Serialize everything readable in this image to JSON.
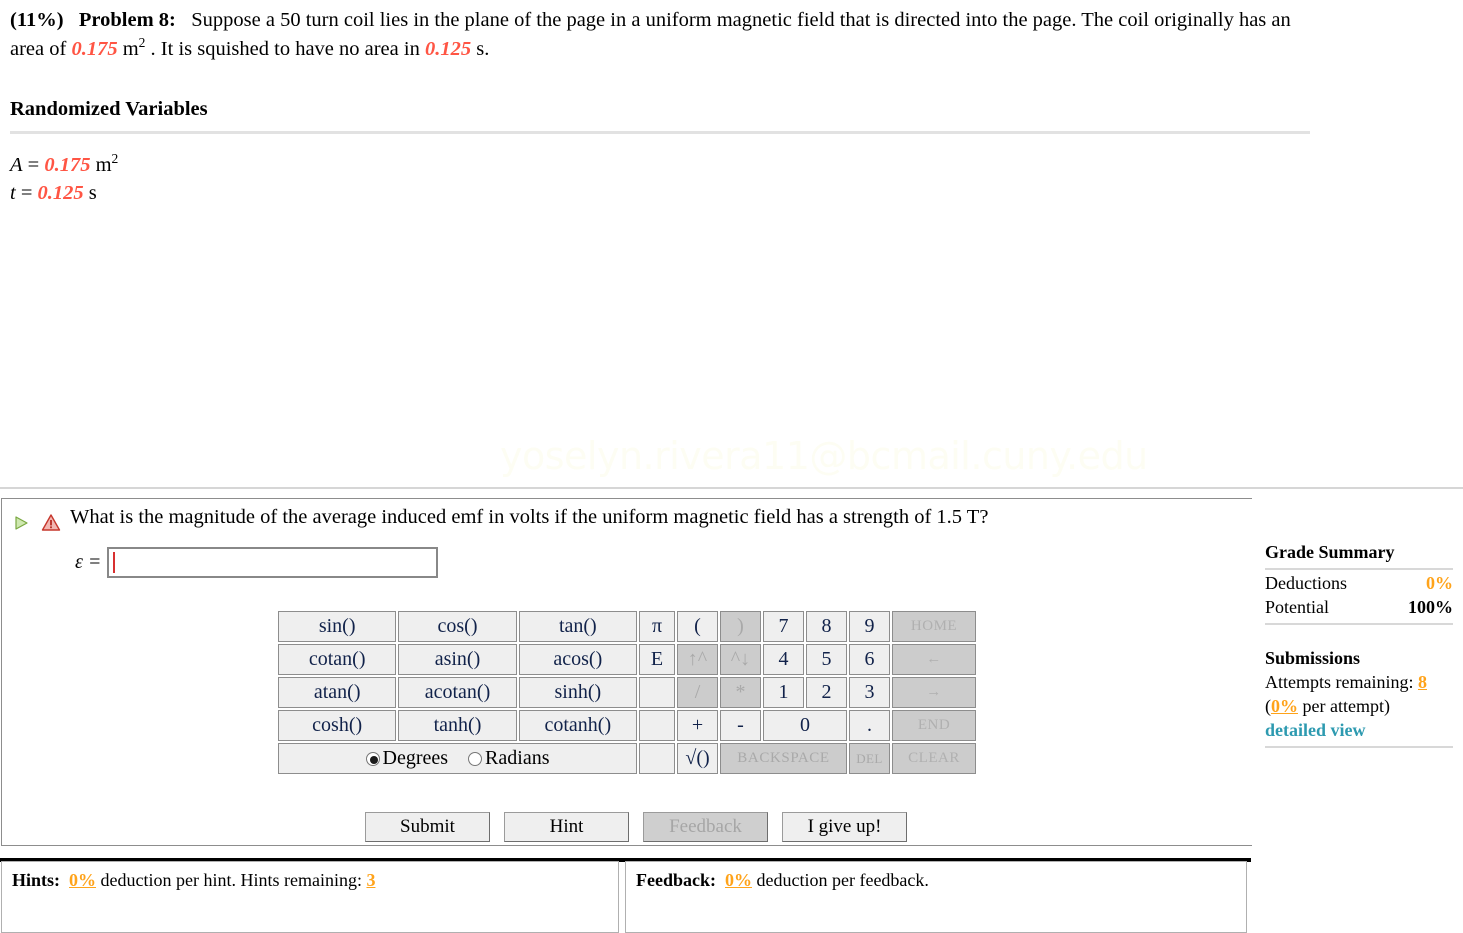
{
  "problem": {
    "percent": "(11%)",
    "label": "Problem 8:",
    "text_part1": "Suppose a 50 turn coil lies in the plane of the page in a uniform magnetic field that is directed into the page. The coil originally has an area of ",
    "area_value": "0.175",
    "text_part2": " m",
    "area_unit_exp": "2",
    "text_part3": " . It is squished to have no area in ",
    "time_value": "0.125",
    "text_part4": " s."
  },
  "randomized": {
    "title": "Randomized Variables",
    "vars": [
      {
        "symbol": "A",
        "eq": " = ",
        "value": "0.175",
        "unit": " m",
        "exp": "2"
      },
      {
        "symbol": "t",
        "eq": " = ",
        "value": "0.125",
        "unit": " s",
        "exp": ""
      }
    ]
  },
  "watermark": "yoselyn.rivera11@bcmail.cuny.edu",
  "question": {
    "text": "What is the magnitude of the average induced emf in volts if the uniform magnetic field has a strength of 1.5 T?",
    "answer_label": "ε =",
    "answer_value": "",
    "answer_placeholder": ""
  },
  "keypad": {
    "rows": [
      [
        {
          "label": "sin()",
          "kind": "fn",
          "disabled": false
        },
        {
          "label": "cos()",
          "kind": "fn",
          "disabled": false
        },
        {
          "label": "tan()",
          "kind": "fn",
          "disabled": false
        },
        {
          "label": "π",
          "kind": "pi",
          "disabled": false
        },
        {
          "label": "(",
          "kind": "op",
          "disabled": false
        },
        {
          "label": ")",
          "kind": "op",
          "disabled": true
        },
        {
          "label": "7",
          "kind": "dg",
          "disabled": false
        },
        {
          "label": "8",
          "kind": "dg",
          "disabled": false
        },
        {
          "label": "9",
          "kind": "dg",
          "disabled": false
        },
        {
          "label": "HOME",
          "kind": "nav",
          "disabled": true
        }
      ],
      [
        {
          "label": "cotan()",
          "kind": "fn",
          "disabled": false
        },
        {
          "label": "asin()",
          "kind": "fn",
          "disabled": false
        },
        {
          "label": "acos()",
          "kind": "fn",
          "disabled": false
        },
        {
          "label": "E",
          "kind": "pi",
          "disabled": false
        },
        {
          "label": "↑^",
          "kind": "op",
          "disabled": true
        },
        {
          "label": "^↓",
          "kind": "op",
          "disabled": true
        },
        {
          "label": "4",
          "kind": "dg",
          "disabled": false
        },
        {
          "label": "5",
          "kind": "dg",
          "disabled": false
        },
        {
          "label": "6",
          "kind": "dg",
          "disabled": false
        },
        {
          "label": "←",
          "kind": "nav",
          "disabled": true
        }
      ],
      [
        {
          "label": "atan()",
          "kind": "fn",
          "disabled": false
        },
        {
          "label": "acotan()",
          "kind": "fn",
          "disabled": false
        },
        {
          "label": "sinh()",
          "kind": "fn",
          "disabled": false
        },
        {
          "label": "",
          "kind": "pi",
          "disabled": false
        },
        {
          "label": "/",
          "kind": "op",
          "disabled": true
        },
        {
          "label": "*",
          "kind": "op",
          "disabled": true
        },
        {
          "label": "1",
          "kind": "dg",
          "disabled": false
        },
        {
          "label": "2",
          "kind": "dg",
          "disabled": false
        },
        {
          "label": "3",
          "kind": "dg",
          "disabled": false
        },
        {
          "label": "→",
          "kind": "nav",
          "disabled": true
        }
      ],
      [
        {
          "label": "cosh()",
          "kind": "fn",
          "disabled": false
        },
        {
          "label": "tanh()",
          "kind": "fn",
          "disabled": false
        },
        {
          "label": "cotanh()",
          "kind": "fn",
          "disabled": false
        },
        {
          "label": "",
          "kind": "pi",
          "disabled": false
        },
        {
          "label": "+",
          "kind": "op",
          "disabled": false
        },
        {
          "label": "-",
          "kind": "op",
          "disabled": false
        },
        {
          "label": "0",
          "kind": "dg2",
          "disabled": false
        },
        {
          "label": ".",
          "kind": "dg",
          "disabled": false
        },
        {
          "label": "END",
          "kind": "nav",
          "disabled": true
        }
      ]
    ],
    "last_row": {
      "mode_degrees": "Degrees",
      "mode_radians": "Radians",
      "selected_mode": "Degrees",
      "blank": "",
      "sqrt": "√()",
      "backspace": "BACKSPACE",
      "del": "DEL",
      "clear": "CLEAR"
    }
  },
  "actions": [
    {
      "label": "Submit",
      "disabled": false
    },
    {
      "label": "Hint",
      "disabled": false
    },
    {
      "label": "Feedback",
      "disabled": true
    },
    {
      "label": "I give up!",
      "disabled": false
    }
  ],
  "grade_summary": {
    "title": "Grade Summary",
    "deductions_label": "Deductions",
    "deductions_value": "0%",
    "potential_label": "Potential",
    "potential_value": "100%",
    "submissions_title": "Submissions",
    "attempts_label": "Attempts remaining:",
    "attempts_value": "8",
    "per_attempt_open": "(",
    "per_attempt_value": "0%",
    "per_attempt_text": " per attempt)",
    "detailed_view": "detailed view"
  },
  "hints_bar": {
    "hints_label": "Hints:",
    "hints_pct": "0%",
    "hints_text_mid": " deduction per hint. Hints remaining: ",
    "hints_remaining": "3",
    "feedback_label": "Feedback:",
    "feedback_pct": "0%",
    "feedback_text": " deduction per feedback."
  },
  "colors": {
    "random_value": "#ff5544",
    "orange": "#ffa31a",
    "link": "#2d9ab0",
    "caret": "#d83030",
    "key_face": "#efefef",
    "key_disabled": "#cccccc"
  }
}
